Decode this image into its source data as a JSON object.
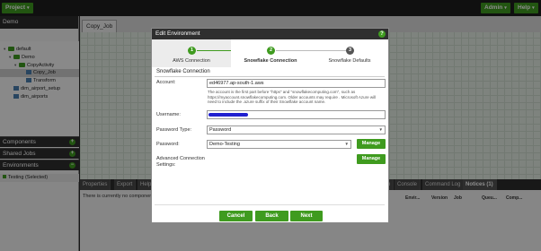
{
  "topbar": {
    "project": "Project",
    "admin": "Admin",
    "help": "Help"
  },
  "left": {
    "title": "Demo",
    "tree": [
      "default",
      "Demo",
      "CopyActivity",
      "Copy_Job",
      "Transform",
      "dim_airport_setup",
      "dim_airports"
    ],
    "components": "Components",
    "shared_jobs": "Shared Jobs",
    "environments": "Environments",
    "env_item": "Testing (Selected)"
  },
  "canvas": {
    "tab": "Copy_Job"
  },
  "bottom": {
    "tabs": [
      "Properties",
      "Export",
      "Help",
      "rch",
      "Console",
      "Command Log",
      "Notices (1)"
    ],
    "message": "There is currently no component s",
    "columns": [
      "Envir...",
      "Version",
      "Job",
      "Queu...",
      "Comp..."
    ]
  },
  "modal": {
    "title": "Edit Environment",
    "help": "?",
    "steps": [
      {
        "num": "1",
        "label": "AWS Connection"
      },
      {
        "num": "2",
        "label": "Snowflake Connection"
      },
      {
        "num": "3",
        "label": "Snowflake Defaults"
      }
    ],
    "section": "Snowflake Connection",
    "account_label": "Account:",
    "account_value": "ed46977.ap-south-1.aws",
    "hint": "The account is the first part before \"https\" and \"snowflakecomputing.com\", such as https://myaccount.snowflakecomputing.com. Older accounts may require . Microsoft Azure will need to include the .azure suffix of their Snowflake account name.",
    "username_label": "Username:",
    "password_type_label": "Password Type:",
    "password_type_value": "Password",
    "password_label": "Password:",
    "password_value": "Demo-Testing",
    "manage": "Manage",
    "advanced_label": "Advanced Connection Settings:",
    "cancel": "Cancel",
    "back": "Back",
    "next": "Next"
  },
  "colors": {
    "accent": "#3f9b1f",
    "dark": "#2f2f2f"
  }
}
